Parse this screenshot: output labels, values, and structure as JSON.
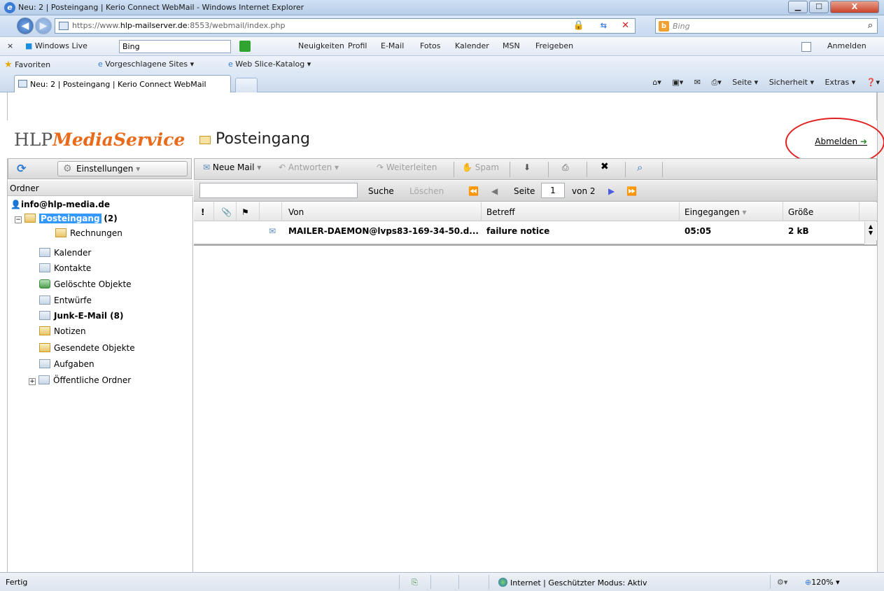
{
  "window": {
    "title": "Neu: 2 | Posteingang | Kerio Connect WebMail - Windows Internet Explorer",
    "minimize": "▁",
    "maximize": "☐",
    "close": "X"
  },
  "address": {
    "url_prefix": "https://www.",
    "url_host": "hlp-mailserver.de",
    "url_rest": ":8553/webmail/index.php",
    "search_placeholder": "Bing"
  },
  "live_toolbar": {
    "close": "×",
    "brand": "Windows Live",
    "search_value": "Bing",
    "links": [
      "Neuigkeiten",
      "Profil",
      "E-Mail",
      "Fotos",
      "Kalender",
      "MSN",
      "Freigeben"
    ],
    "signin": "Anmelden"
  },
  "favorites_bar": {
    "favorites": "Favoriten",
    "suggested": "Vorgeschlagene Sites ▾",
    "webslice": "Web Slice-Katalog ▾"
  },
  "tabs": {
    "active": "Neu: 2 | Posteingang | Kerio Connect WebMail",
    "commands": [
      "Seite ▾",
      "Sicherheit ▾",
      "Extras ▾"
    ]
  },
  "app": {
    "logo_a": "HLP",
    "logo_b": "MediaService",
    "page_title": "Posteingang",
    "logout": "Abmelden",
    "settings": "Einstellungen",
    "folder_header": "Ordner",
    "account": "info@hlp-media.de",
    "folders": [
      {
        "label": "Posteingang",
        "count": "(2)"
      },
      {
        "label": "Rechnungen"
      },
      {
        "label": "Kalender"
      },
      {
        "label": "Kontakte"
      },
      {
        "label": "Gelöschte Objekte"
      },
      {
        "label": "Entwürfe"
      },
      {
        "label": "Junk-E-Mail (8)"
      },
      {
        "label": "Notizen"
      },
      {
        "label": "Gesendete Objekte"
      },
      {
        "label": "Aufgaben"
      },
      {
        "label": "Öffentliche Ordner"
      }
    ]
  },
  "mail_toolbar": {
    "new": "Neue Mail",
    "reply": "Antworten",
    "forward": "Weiterleiten",
    "spam": "Spam"
  },
  "search_bar": {
    "search": "Suche",
    "clear": "Löschen",
    "page_label": "Seite",
    "page_value": "1",
    "of_pages": "von 2"
  },
  "grid": {
    "columns": {
      "flag": "!",
      "from": "Von",
      "subject": "Betreff",
      "received": "Eingegangen",
      "size": "Größe"
    },
    "rows": [
      {
        "from": "MAILER-DAEMON@lvps83-169-34-50.d...",
        "subject": "failure notice",
        "received": "05:05",
        "size": "2 kB"
      }
    ]
  },
  "status": {
    "left": "Fertig",
    "zone": "Internet | Geschützter Modus: Aktiv",
    "zoom": "120%"
  },
  "colors": {
    "accent": "#3399ff",
    "logo_orange": "#e86a1a",
    "annotation": "#e02020"
  }
}
